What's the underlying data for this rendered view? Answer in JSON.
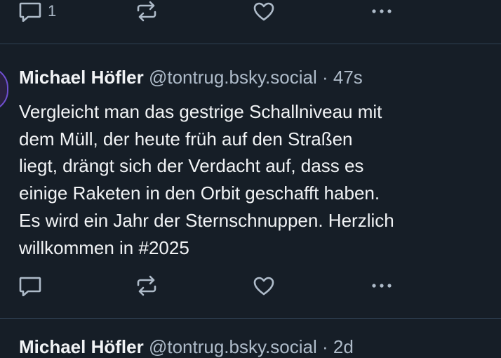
{
  "top_post": {
    "reply_count": "1",
    "icons": [
      "reply-icon",
      "repost-icon",
      "like-icon",
      "more-icon"
    ]
  },
  "main_post": {
    "author_name": "Michael Höfler",
    "handle": "@tontrug.bsky.social",
    "separator": "·",
    "time": "47s",
    "text": "Vergleicht man das gestrige Schallniveau mit\ndem Müll, der heute früh auf den Straßen\nliegt, drängt sich der Verdacht auf, dass es\neinige Raketen in den Orbit geschafft haben.\nEs wird ein Jahr der Sternschnuppen. Herzlich\nwillkommen in #2025",
    "icons": [
      "reply-icon",
      "repost-icon",
      "like-icon",
      "more-icon"
    ]
  },
  "next_post": {
    "author_name": "Michael Höfler",
    "handle": "@tontrug.bsky.social",
    "separator": "·",
    "time": "2d"
  },
  "colors": {
    "background": "#161e27",
    "text": "#f1f3f5",
    "muted": "#aebbc9",
    "divider": "#2e4052",
    "icon": "#aebbc9"
  }
}
